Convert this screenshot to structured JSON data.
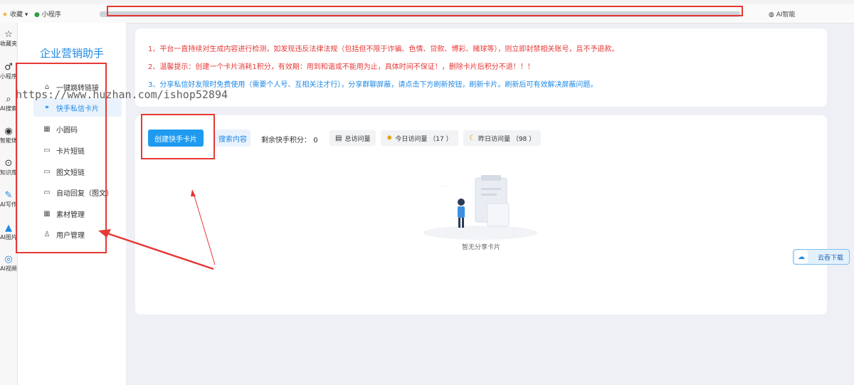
{
  "bookmarks": {
    "favorites": "收藏",
    "miniprogram": "小程序",
    "ai_smart": "AI智能"
  },
  "browser_sidebar": [
    {
      "icon": "☆",
      "label": "收藏夹"
    },
    {
      "icon": "♂",
      "label": "小程序"
    },
    {
      "icon": "⌕",
      "label": "AI搜索"
    },
    {
      "icon": "◉",
      "label": "智能体"
    },
    {
      "icon": "⊙",
      "label": "知识库"
    },
    {
      "icon": "✎",
      "label": "AI写作"
    },
    {
      "icon": "▲",
      "label": "AI图片"
    },
    {
      "icon": "◎",
      "label": "AI视频"
    }
  ],
  "app": {
    "brand": "企业营销助手",
    "menu": [
      {
        "icon": "⌂",
        "label": "一键跳转链接"
      },
      {
        "icon": "⚭",
        "label": "快手私信卡片"
      },
      {
        "icon": "▦",
        "label": "小圆码"
      },
      {
        "icon": "▭",
        "label": "卡片短链"
      },
      {
        "icon": "▭",
        "label": "图文短链"
      },
      {
        "icon": "▭",
        "label": "自动回复（图文）"
      },
      {
        "icon": "▦",
        "label": "素材管理"
      },
      {
        "icon": "♙",
        "label": "用户管理"
      }
    ]
  },
  "notice": {
    "line1": "1、平台一直持续对生成内容进行检测，如发现违反法律法规（包括但不限于诈骗、色情、贷款、博彩、赌球等），则立即封禁相关账号，且不予退款。",
    "line2": "2、温馨提示：创建一个卡片消耗1积分，有效期：用到和谐或不能用为止，具体时间不保证！，删除卡片后积分不退！！！",
    "line3": "3、分享私信好友限时免费使用（需要个人号、互相关注才行），分享群聊屏蔽，请点击下方刷新按钮，刷新卡片。刷新后可有效解决屏蔽问题。"
  },
  "toolbar": {
    "create_label": "创建快手卡片",
    "search_label": "搜索内容",
    "points_label": "剩余快手积分：",
    "points_value": "0",
    "total_visits": "总访问量",
    "today_visits": "今日访问量 （17 ）",
    "yesterday_visits": "昨日访问量 （98 ）"
  },
  "empty_state": "暂无分享卡片",
  "watermark": "https://www.huzhan.com/ishop52894",
  "cloud_download": "云吞下载",
  "colors": {
    "accent": "#1e9bf0",
    "warning": "#e53935",
    "annotation": "#e53935"
  }
}
